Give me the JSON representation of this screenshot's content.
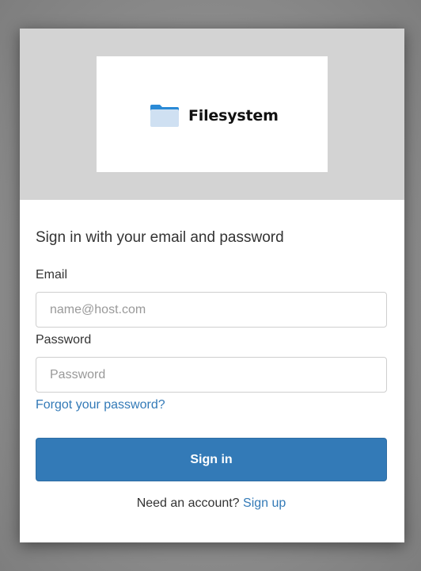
{
  "logo": {
    "text": "Filesystem",
    "icon": "folder-icon",
    "colors": {
      "folder_front": "#cfe0f2",
      "folder_tab": "#2a8ad6"
    }
  },
  "form": {
    "heading": "Sign in with your email and password",
    "email_label": "Email",
    "email_placeholder": "name@host.com",
    "email_value": "",
    "password_label": "Password",
    "password_placeholder": "Password",
    "password_value": "",
    "forgot_link": "Forgot your password?",
    "submit_label": "Sign in",
    "signup_prompt": "Need an account?",
    "signup_link": "Sign up"
  },
  "colors": {
    "banner_bg": "#d3d3d3",
    "primary": "#337ab7",
    "text": "#333333",
    "backdrop": "#8a8a8a"
  }
}
